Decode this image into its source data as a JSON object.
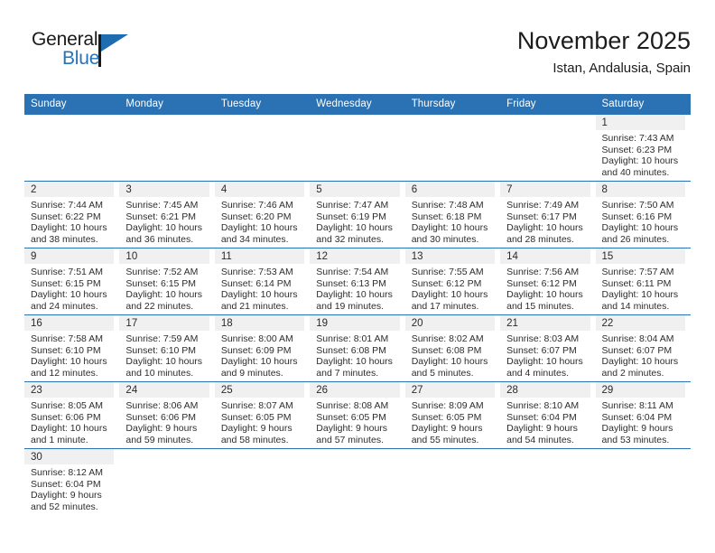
{
  "brand": {
    "name_part1": "General",
    "name_part2": "Blue",
    "accent_color": "#2573b8"
  },
  "header": {
    "title": "November 2025",
    "location": "Istan, Andalusia, Spain"
  },
  "theme": {
    "header_blue": "#2b72b4",
    "daynum_band": "#f0f0f0",
    "text": "#2d2d2d"
  },
  "weekdays": [
    "Sunday",
    "Monday",
    "Tuesday",
    "Wednesday",
    "Thursday",
    "Friday",
    "Saturday"
  ],
  "weeks": [
    [
      {
        "day": "",
        "blank": true,
        "sunrise": "",
        "sunset": "",
        "daylight1": "",
        "daylight2": ""
      },
      {
        "day": "",
        "blank": true,
        "sunrise": "",
        "sunset": "",
        "daylight1": "",
        "daylight2": ""
      },
      {
        "day": "",
        "blank": true,
        "sunrise": "",
        "sunset": "",
        "daylight1": "",
        "daylight2": ""
      },
      {
        "day": "",
        "blank": true,
        "sunrise": "",
        "sunset": "",
        "daylight1": "",
        "daylight2": ""
      },
      {
        "day": "",
        "blank": true,
        "sunrise": "",
        "sunset": "",
        "daylight1": "",
        "daylight2": ""
      },
      {
        "day": "",
        "blank": true,
        "sunrise": "",
        "sunset": "",
        "daylight1": "",
        "daylight2": ""
      },
      {
        "day": "1",
        "blank": false,
        "sunrise": "Sunrise: 7:43 AM",
        "sunset": "Sunset: 6:23 PM",
        "daylight1": "Daylight: 10 hours",
        "daylight2": "and 40 minutes."
      }
    ],
    [
      {
        "day": "2",
        "blank": false,
        "sunrise": "Sunrise: 7:44 AM",
        "sunset": "Sunset: 6:22 PM",
        "daylight1": "Daylight: 10 hours",
        "daylight2": "and 38 minutes."
      },
      {
        "day": "3",
        "blank": false,
        "sunrise": "Sunrise: 7:45 AM",
        "sunset": "Sunset: 6:21 PM",
        "daylight1": "Daylight: 10 hours",
        "daylight2": "and 36 minutes."
      },
      {
        "day": "4",
        "blank": false,
        "sunrise": "Sunrise: 7:46 AM",
        "sunset": "Sunset: 6:20 PM",
        "daylight1": "Daylight: 10 hours",
        "daylight2": "and 34 minutes."
      },
      {
        "day": "5",
        "blank": false,
        "sunrise": "Sunrise: 7:47 AM",
        "sunset": "Sunset: 6:19 PM",
        "daylight1": "Daylight: 10 hours",
        "daylight2": "and 32 minutes."
      },
      {
        "day": "6",
        "blank": false,
        "sunrise": "Sunrise: 7:48 AM",
        "sunset": "Sunset: 6:18 PM",
        "daylight1": "Daylight: 10 hours",
        "daylight2": "and 30 minutes."
      },
      {
        "day": "7",
        "blank": false,
        "sunrise": "Sunrise: 7:49 AM",
        "sunset": "Sunset: 6:17 PM",
        "daylight1": "Daylight: 10 hours",
        "daylight2": "and 28 minutes."
      },
      {
        "day": "8",
        "blank": false,
        "sunrise": "Sunrise: 7:50 AM",
        "sunset": "Sunset: 6:16 PM",
        "daylight1": "Daylight: 10 hours",
        "daylight2": "and 26 minutes."
      }
    ],
    [
      {
        "day": "9",
        "blank": false,
        "sunrise": "Sunrise: 7:51 AM",
        "sunset": "Sunset: 6:15 PM",
        "daylight1": "Daylight: 10 hours",
        "daylight2": "and 24 minutes."
      },
      {
        "day": "10",
        "blank": false,
        "sunrise": "Sunrise: 7:52 AM",
        "sunset": "Sunset: 6:15 PM",
        "daylight1": "Daylight: 10 hours",
        "daylight2": "and 22 minutes."
      },
      {
        "day": "11",
        "blank": false,
        "sunrise": "Sunrise: 7:53 AM",
        "sunset": "Sunset: 6:14 PM",
        "daylight1": "Daylight: 10 hours",
        "daylight2": "and 21 minutes."
      },
      {
        "day": "12",
        "blank": false,
        "sunrise": "Sunrise: 7:54 AM",
        "sunset": "Sunset: 6:13 PM",
        "daylight1": "Daylight: 10 hours",
        "daylight2": "and 19 minutes."
      },
      {
        "day": "13",
        "blank": false,
        "sunrise": "Sunrise: 7:55 AM",
        "sunset": "Sunset: 6:12 PM",
        "daylight1": "Daylight: 10 hours",
        "daylight2": "and 17 minutes."
      },
      {
        "day": "14",
        "blank": false,
        "sunrise": "Sunrise: 7:56 AM",
        "sunset": "Sunset: 6:12 PM",
        "daylight1": "Daylight: 10 hours",
        "daylight2": "and 15 minutes."
      },
      {
        "day": "15",
        "blank": false,
        "sunrise": "Sunrise: 7:57 AM",
        "sunset": "Sunset: 6:11 PM",
        "daylight1": "Daylight: 10 hours",
        "daylight2": "and 14 minutes."
      }
    ],
    [
      {
        "day": "16",
        "blank": false,
        "sunrise": "Sunrise: 7:58 AM",
        "sunset": "Sunset: 6:10 PM",
        "daylight1": "Daylight: 10 hours",
        "daylight2": "and 12 minutes."
      },
      {
        "day": "17",
        "blank": false,
        "sunrise": "Sunrise: 7:59 AM",
        "sunset": "Sunset: 6:10 PM",
        "daylight1": "Daylight: 10 hours",
        "daylight2": "and 10 minutes."
      },
      {
        "day": "18",
        "blank": false,
        "sunrise": "Sunrise: 8:00 AM",
        "sunset": "Sunset: 6:09 PM",
        "daylight1": "Daylight: 10 hours",
        "daylight2": "and 9 minutes."
      },
      {
        "day": "19",
        "blank": false,
        "sunrise": "Sunrise: 8:01 AM",
        "sunset": "Sunset: 6:08 PM",
        "daylight1": "Daylight: 10 hours",
        "daylight2": "and 7 minutes."
      },
      {
        "day": "20",
        "blank": false,
        "sunrise": "Sunrise: 8:02 AM",
        "sunset": "Sunset: 6:08 PM",
        "daylight1": "Daylight: 10 hours",
        "daylight2": "and 5 minutes."
      },
      {
        "day": "21",
        "blank": false,
        "sunrise": "Sunrise: 8:03 AM",
        "sunset": "Sunset: 6:07 PM",
        "daylight1": "Daylight: 10 hours",
        "daylight2": "and 4 minutes."
      },
      {
        "day": "22",
        "blank": false,
        "sunrise": "Sunrise: 8:04 AM",
        "sunset": "Sunset: 6:07 PM",
        "daylight1": "Daylight: 10 hours",
        "daylight2": "and 2 minutes."
      }
    ],
    [
      {
        "day": "23",
        "blank": false,
        "sunrise": "Sunrise: 8:05 AM",
        "sunset": "Sunset: 6:06 PM",
        "daylight1": "Daylight: 10 hours",
        "daylight2": "and 1 minute."
      },
      {
        "day": "24",
        "blank": false,
        "sunrise": "Sunrise: 8:06 AM",
        "sunset": "Sunset: 6:06 PM",
        "daylight1": "Daylight: 9 hours",
        "daylight2": "and 59 minutes."
      },
      {
        "day": "25",
        "blank": false,
        "sunrise": "Sunrise: 8:07 AM",
        "sunset": "Sunset: 6:05 PM",
        "daylight1": "Daylight: 9 hours",
        "daylight2": "and 58 minutes."
      },
      {
        "day": "26",
        "blank": false,
        "sunrise": "Sunrise: 8:08 AM",
        "sunset": "Sunset: 6:05 PM",
        "daylight1": "Daylight: 9 hours",
        "daylight2": "and 57 minutes."
      },
      {
        "day": "27",
        "blank": false,
        "sunrise": "Sunrise: 8:09 AM",
        "sunset": "Sunset: 6:05 PM",
        "daylight1": "Daylight: 9 hours",
        "daylight2": "and 55 minutes."
      },
      {
        "day": "28",
        "blank": false,
        "sunrise": "Sunrise: 8:10 AM",
        "sunset": "Sunset: 6:04 PM",
        "daylight1": "Daylight: 9 hours",
        "daylight2": "and 54 minutes."
      },
      {
        "day": "29",
        "blank": false,
        "sunrise": "Sunrise: 8:11 AM",
        "sunset": "Sunset: 6:04 PM",
        "daylight1": "Daylight: 9 hours",
        "daylight2": "and 53 minutes."
      }
    ],
    [
      {
        "day": "30",
        "blank": false,
        "sunrise": "Sunrise: 8:12 AM",
        "sunset": "Sunset: 6:04 PM",
        "daylight1": "Daylight: 9 hours",
        "daylight2": "and 52 minutes."
      },
      {
        "day": "",
        "blank": true,
        "sunrise": "",
        "sunset": "",
        "daylight1": "",
        "daylight2": ""
      },
      {
        "day": "",
        "blank": true,
        "sunrise": "",
        "sunset": "",
        "daylight1": "",
        "daylight2": ""
      },
      {
        "day": "",
        "blank": true,
        "sunrise": "",
        "sunset": "",
        "daylight1": "",
        "daylight2": ""
      },
      {
        "day": "",
        "blank": true,
        "sunrise": "",
        "sunset": "",
        "daylight1": "",
        "daylight2": ""
      },
      {
        "day": "",
        "blank": true,
        "sunrise": "",
        "sunset": "",
        "daylight1": "",
        "daylight2": ""
      },
      {
        "day": "",
        "blank": true,
        "sunrise": "",
        "sunset": "",
        "daylight1": "",
        "daylight2": ""
      }
    ]
  ]
}
